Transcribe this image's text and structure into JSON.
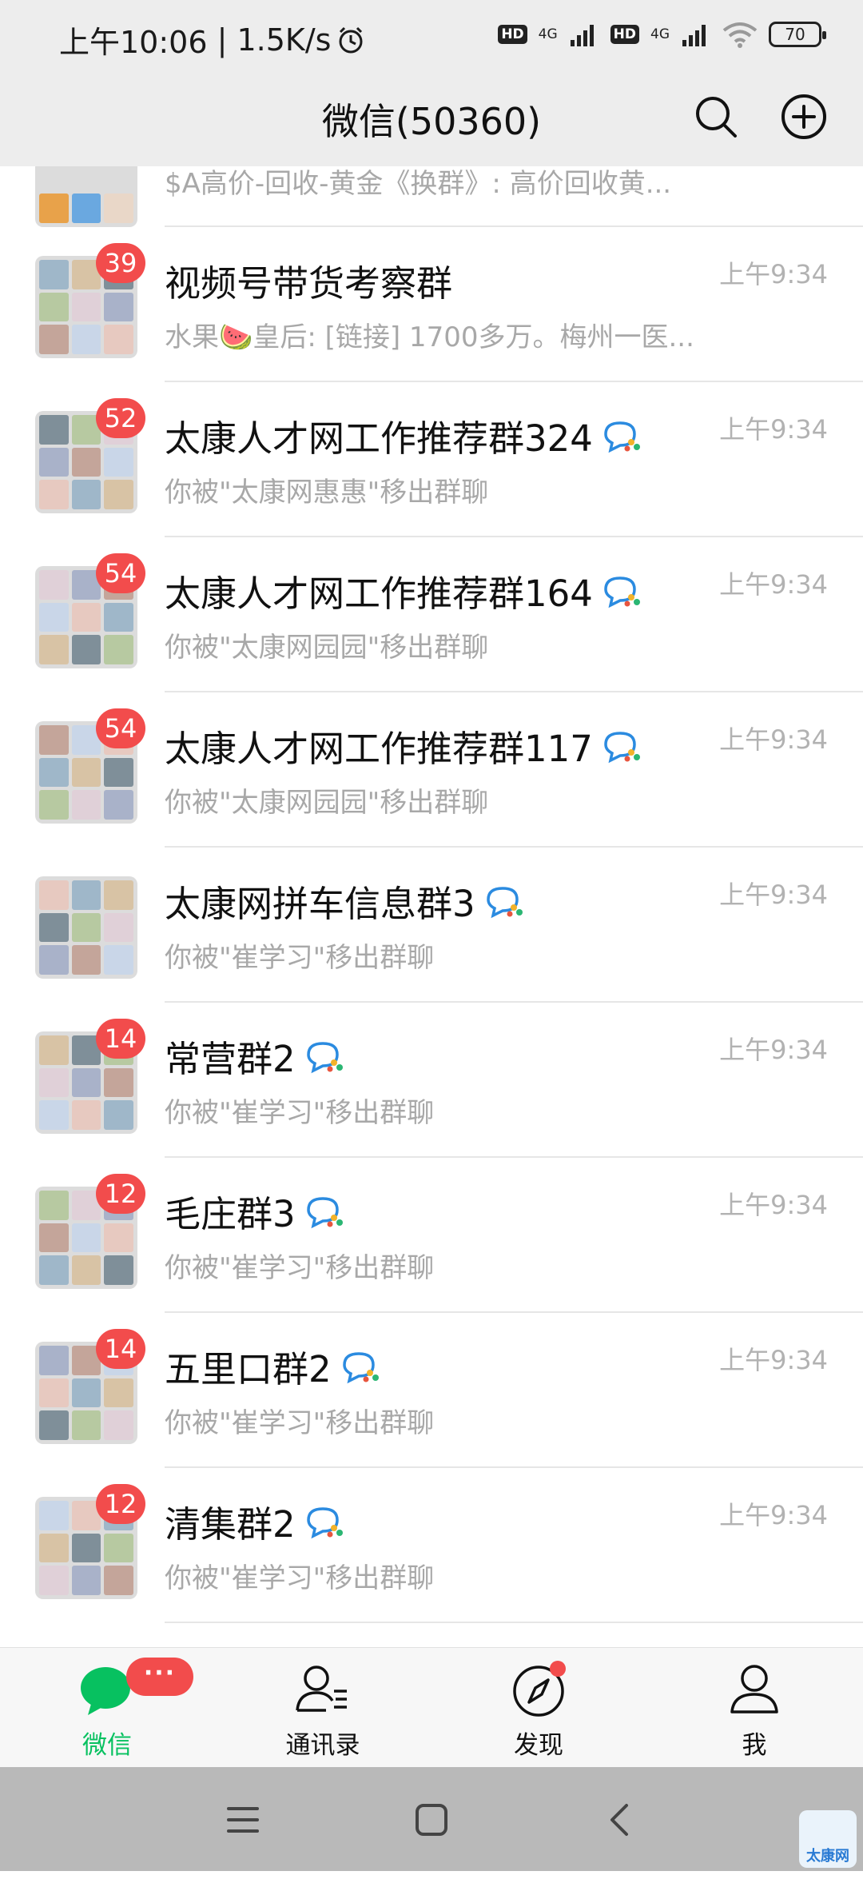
{
  "status_bar": {
    "time": "上午10:06",
    "speed": "1.5K/s",
    "hd1": "HD",
    "net1": "4G",
    "hd2": "HD",
    "net2": "4G",
    "battery": "70"
  },
  "header": {
    "title": "微信(50360)",
    "search_icon": "search-icon",
    "add_icon": "plus-circle-icon"
  },
  "chats": [
    {
      "title": "",
      "preview": "$A高价-回收-黄金《换群》: 高价回收黄...",
      "time": "",
      "badge": ""
    },
    {
      "title": "视频号带货考察群",
      "preview": "水果🍉皇后: [链接] 1700多万。梅州一医...",
      "time": "上午9:34",
      "badge": "39"
    },
    {
      "title": "太康人才网工作推荐群324",
      "preview": "你被\"太康网惠惠\"移出群聊",
      "time": "上午9:34",
      "badge": "52"
    },
    {
      "title": "太康人才网工作推荐群164",
      "preview": "你被\"太康网园园\"移出群聊",
      "time": "上午9:34",
      "badge": "54"
    },
    {
      "title": "太康人才网工作推荐群117",
      "preview": "你被\"太康网园园\"移出群聊",
      "time": "上午9:34",
      "badge": "54"
    },
    {
      "title": "太康网拼车信息群3",
      "preview": "你被\"崔学习\"移出群聊",
      "time": "上午9:34",
      "badge": ""
    },
    {
      "title": "常营群2",
      "preview": "你被\"崔学习\"移出群聊",
      "time": "上午9:34",
      "badge": "14"
    },
    {
      "title": "毛庄群3",
      "preview": "你被\"崔学习\"移出群聊",
      "time": "上午9:34",
      "badge": "12"
    },
    {
      "title": "五里口群2",
      "preview": "你被\"崔学习\"移出群聊",
      "time": "上午9:34",
      "badge": "14"
    },
    {
      "title": "清集群2",
      "preview": "你被\"崔学习\"移出群聊",
      "time": "上午9:34",
      "badge": "12"
    }
  ],
  "tabs": [
    {
      "label": "微信",
      "icon": "chat-bubble-icon",
      "badge": "···"
    },
    {
      "label": "通讯录",
      "icon": "contacts-icon"
    },
    {
      "label": "发现",
      "icon": "compass-icon"
    },
    {
      "label": "我",
      "icon": "person-icon"
    }
  ],
  "watermark": "太康网",
  "colors": {
    "accent": "#07c160",
    "badge": "#f24c4c",
    "header_bg": "#ededed"
  }
}
